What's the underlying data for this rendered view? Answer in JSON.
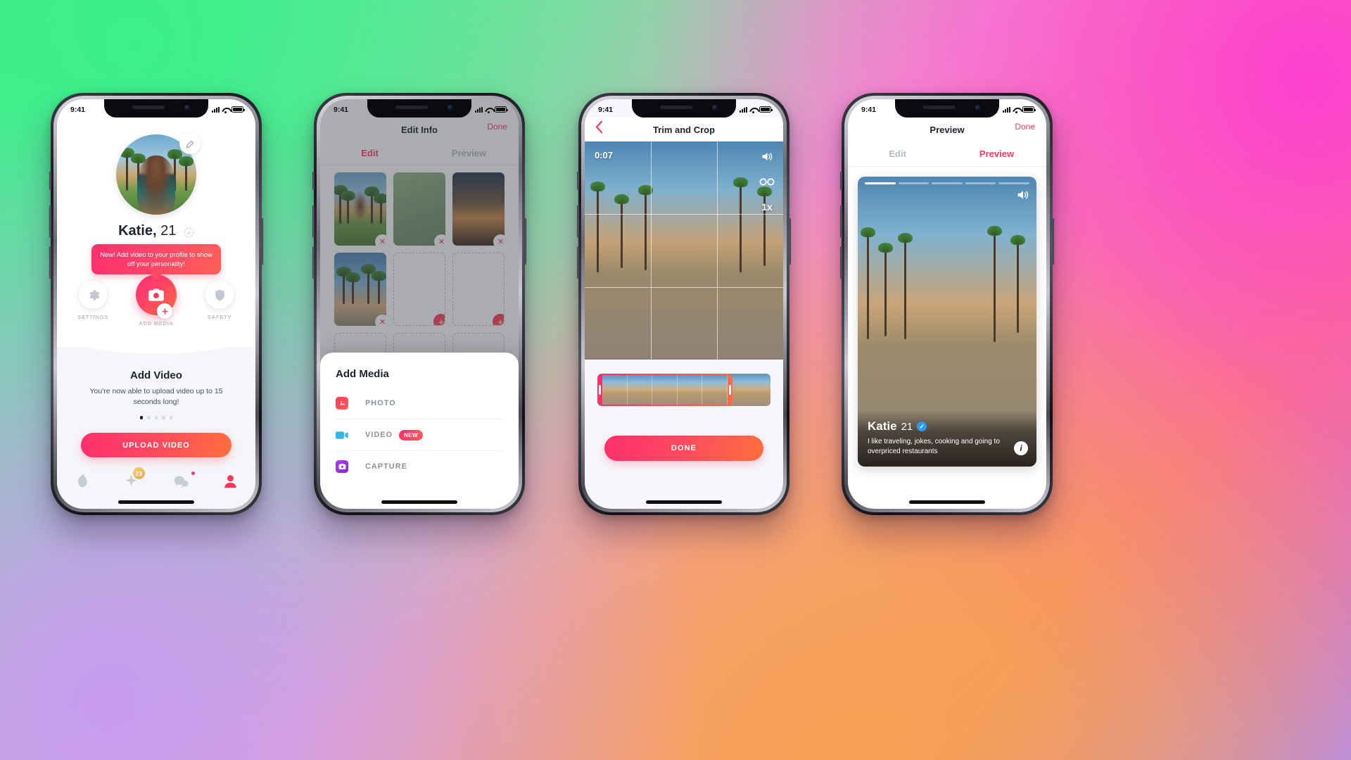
{
  "status_bar": {
    "time": "9:41"
  },
  "phone1": {
    "name": "Katie,",
    "age": "21",
    "verified_icon": "dashed-check-icon",
    "edit_icon": "pencil-icon",
    "tooltip": "New! Add video to your profile to show off your personality!",
    "actions": [
      {
        "label": "SETTINGS",
        "icon": "gear-icon"
      },
      {
        "label": "ADD MEDIA",
        "icon": "camera-icon"
      },
      {
        "label": "SAFETY",
        "icon": "shield-icon"
      }
    ],
    "card_title": "Add Video",
    "card_subtitle": "You're now able to upload video up to 15 seconds long!",
    "dots": 5,
    "active_dot": 0,
    "upload_label": "UPLOAD VIDEO",
    "nav": [
      {
        "icon": "flame-icon",
        "badge": ""
      },
      {
        "icon": "sparkle-icon",
        "badge": "23"
      },
      {
        "icon": "chat-icon",
        "badge": "dot"
      },
      {
        "icon": "profile-icon",
        "badge": ""
      }
    ]
  },
  "phone2": {
    "title": "Edit Info",
    "done_label": "Done",
    "tabs": [
      {
        "label": "Edit",
        "active": true
      },
      {
        "label": "Preview",
        "active": false
      }
    ],
    "grid": [
      {
        "type": "photo",
        "style": "katie",
        "remove_icon": "close-icon"
      },
      {
        "type": "photo",
        "style": "green",
        "remove_icon": "close-icon"
      },
      {
        "type": "photo",
        "style": "road",
        "remove_icon": "close-icon"
      },
      {
        "type": "photo",
        "style": "sky",
        "remove_icon": "close-icon"
      },
      {
        "type": "empty",
        "add_icon": "plus-icon"
      },
      {
        "type": "empty",
        "add_icon": "plus-icon"
      },
      {
        "type": "empty"
      },
      {
        "type": "empty"
      },
      {
        "type": "empty"
      }
    ],
    "sheet": {
      "heading": "Add Media",
      "items": [
        {
          "label": "PHOTO",
          "icon": "image-icon",
          "color": "#fd3a5c",
          "badge": ""
        },
        {
          "label": "VIDEO",
          "icon": "video-camera-icon",
          "color": "#2eb8f0",
          "badge": "NEW"
        },
        {
          "label": "CAPTURE",
          "icon": "camera-icon",
          "color": "#a733f0",
          "badge": ""
        }
      ]
    }
  },
  "phone3": {
    "title": "Trim and Crop",
    "back_icon": "chevron-left-icon",
    "timestamp": "0:07",
    "controls": [
      {
        "icon": "speaker-icon",
        "label": ""
      },
      {
        "icon": "loop-infinity-icon",
        "label": ""
      },
      {
        "icon": "speed-icon",
        "label": "1x"
      }
    ],
    "done_label": "DONE"
  },
  "phone4": {
    "title": "Preview",
    "done_label": "Done",
    "tabs": [
      {
        "label": "Edit",
        "active": false
      },
      {
        "label": "Preview",
        "active": true
      }
    ],
    "card": {
      "name": "Katie",
      "age": "21",
      "verified_icon": "verified-check-icon",
      "bio": "I like traveling, jokes, cooking and going to overpriced restaurants",
      "speaker_icon": "speaker-icon",
      "info_icon": "info-icon",
      "progress_segments": 5,
      "active_segment": 0
    }
  },
  "colors": {
    "accent_pink": "#fd2f6c",
    "accent_orange": "#ff6f3c",
    "link_red": "#fd3a5c",
    "muted_gray": "#b6bcc5"
  }
}
